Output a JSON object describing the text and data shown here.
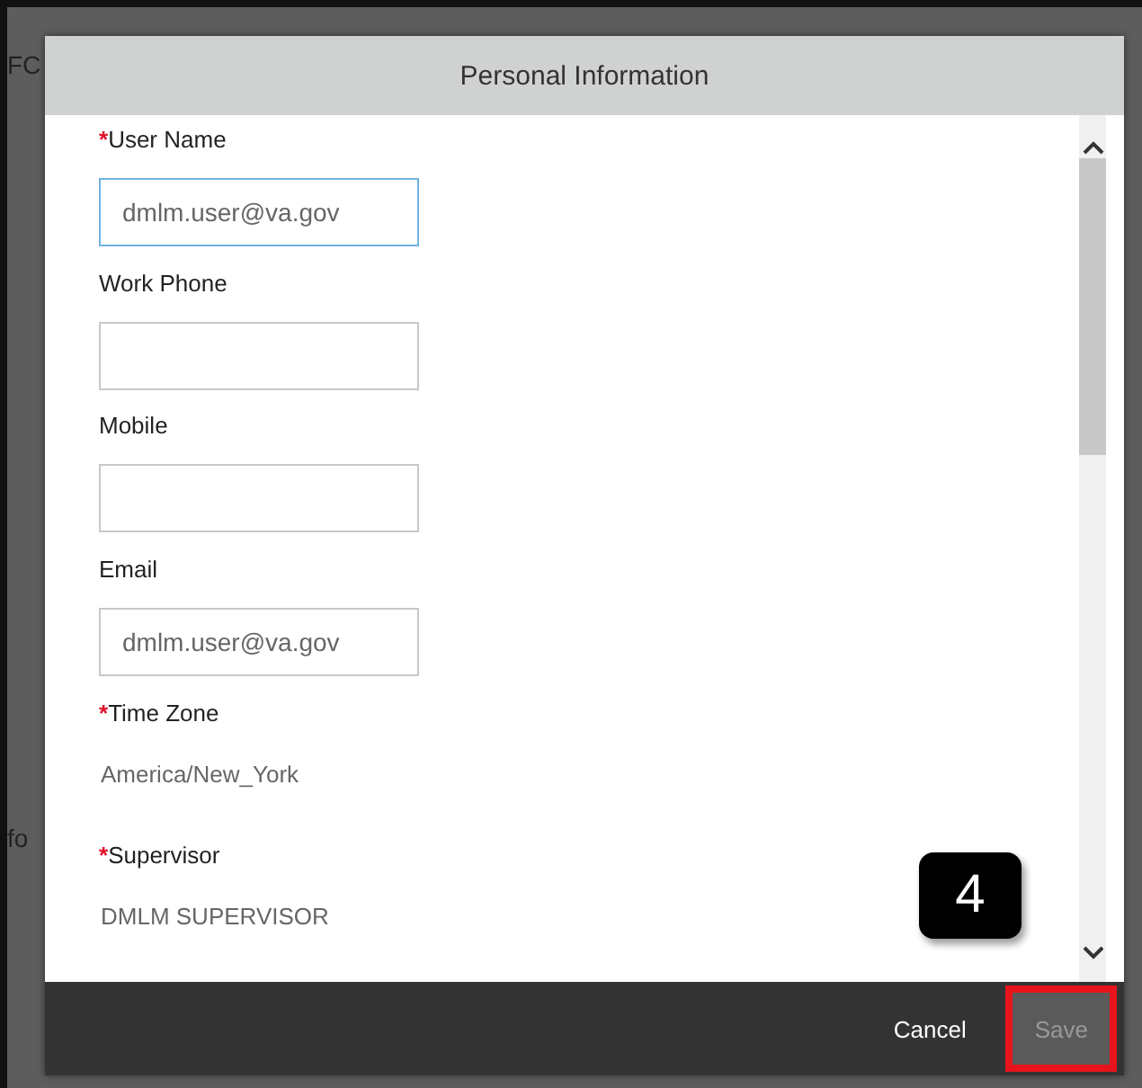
{
  "backdrop_texts": [
    "FC",
    "fo"
  ],
  "dialog": {
    "title": "Personal Information",
    "fields": [
      {
        "label": "User Name",
        "required_mark": "*",
        "kind": "input",
        "value": "dmlm.user@va.gov",
        "focused": true
      },
      {
        "label": "Work Phone",
        "kind": "input",
        "focused": false
      },
      {
        "label": "Mobile",
        "kind": "input",
        "focused": false
      },
      {
        "label": "Email",
        "kind": "input",
        "value": "dmlm.user@va.gov",
        "focused": false
      },
      {
        "label": "Time Zone",
        "required_mark": "*",
        "kind": "text",
        "value": "America/New_York"
      },
      {
        "label": "Supervisor",
        "required_mark": "*",
        "kind": "text",
        "value": "DMLM SUPERVISOR"
      }
    ],
    "buttons": [
      {
        "label": "Cancel",
        "disabled": false,
        "highlighted": false
      },
      {
        "label": "Save",
        "disabled": true,
        "highlighted": true
      }
    ]
  },
  "callout": "4"
}
